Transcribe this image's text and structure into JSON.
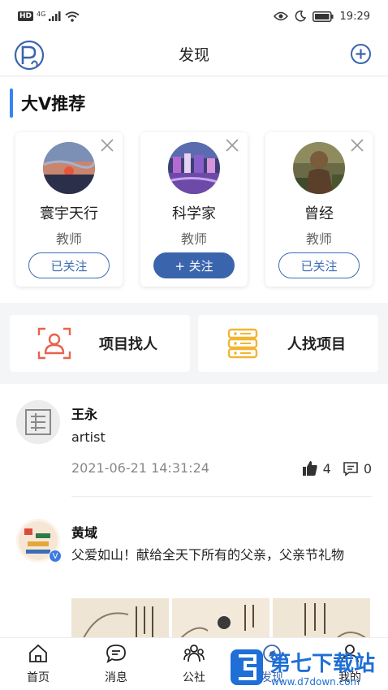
{
  "status": {
    "hd": "HD",
    "net": "4G",
    "time": "19:29"
  },
  "nav": {
    "title": "发现"
  },
  "recommend": {
    "title": "大V推荐",
    "cards": [
      {
        "name": "寰宇天行",
        "role": "教师",
        "follow": "已关注"
      },
      {
        "name": "科学家",
        "role": "教师",
        "follow": "+ 关注"
      },
      {
        "name": "曾经",
        "role": "教师",
        "follow": "已关注"
      }
    ]
  },
  "actions": {
    "find_people": "项目找人",
    "find_project": "人找项目"
  },
  "feed": {
    "posts": [
      {
        "author": "王永",
        "text": "artist",
        "time": "2021-06-21 14:31:24",
        "likes": "4",
        "comments": "0"
      },
      {
        "author": "黄域",
        "text": "父爱如山！献给全天下所有的父亲，父亲节礼物",
        "badge": "V"
      }
    ]
  },
  "tabbar": {
    "items": [
      "首页",
      "消息",
      "公社",
      "发现",
      "我的"
    ]
  },
  "watermark": {
    "brand": "第七下载站",
    "url": "www.d7down.com"
  },
  "colors": {
    "accent": "#3a65ad",
    "section_bar": "#3b82f6",
    "people_icon": "#e8624f",
    "project_icon": "#f2b531"
  }
}
